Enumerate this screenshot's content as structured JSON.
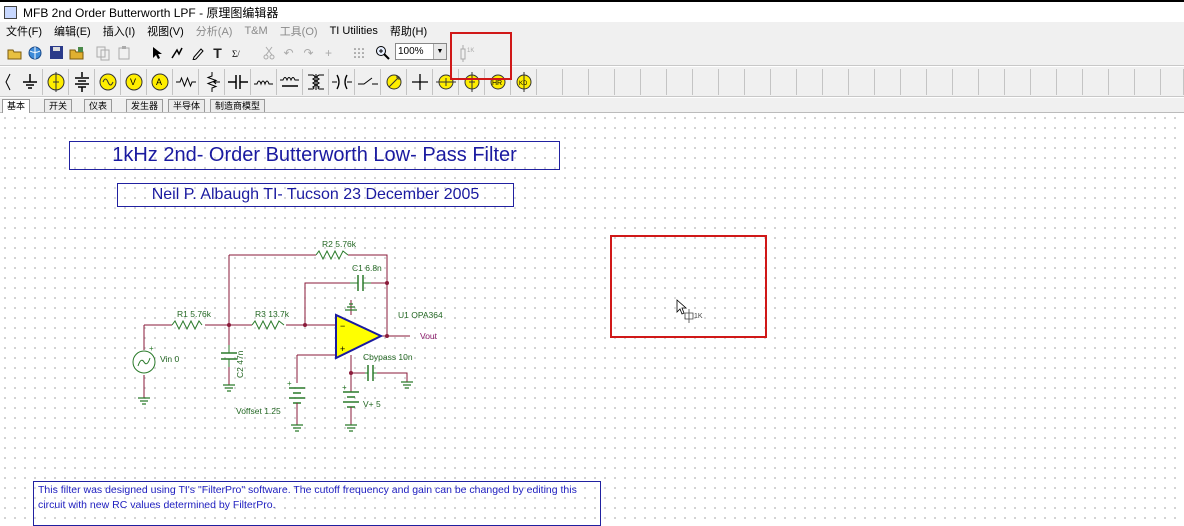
{
  "window": {
    "title": "MFB 2nd Order Butterworth LPF - 原理图编辑器"
  },
  "menu": [
    {
      "label": "文件(F)",
      "enabled": true
    },
    {
      "label": "编辑(E)",
      "enabled": true
    },
    {
      "label": "插入(I)",
      "enabled": true
    },
    {
      "label": "视图(V)",
      "enabled": true
    },
    {
      "label": "分析(A)",
      "enabled": false
    },
    {
      "label": "T&M",
      "enabled": false
    },
    {
      "label": "工具(O)",
      "enabled": false
    },
    {
      "label": "TI Utilities",
      "enabled": true
    },
    {
      "label": "帮助(H)",
      "enabled": true
    }
  ],
  "toolbar": {
    "zoom_value": "100%"
  },
  "tabs": [
    {
      "label": "基本",
      "active": true
    },
    {
      "label": "开关",
      "active": false
    },
    {
      "label": "仪表",
      "active": false
    },
    {
      "label": "发生器",
      "active": false
    },
    {
      "label": "半导体",
      "active": false
    },
    {
      "label": "制造商模型",
      "active": false
    }
  ],
  "schematic": {
    "title": "1kHz 2nd- Order Butterworth Low- Pass Filter",
    "author_line": "Neil P. Albaugh  TI- Tucson  23 December 2005",
    "components": {
      "r1": "R1 5.76k",
      "r2": "R2 5.76k",
      "r3": "R3 13.7k",
      "c1": "C1 6.8n",
      "c2": "C2 47n",
      "u1": "U1 OPA364",
      "vout": "Vout",
      "vin": "Vin 0",
      "cbypass": "Cbypass 10n",
      "vplus": "V+ 5",
      "voffset": "Voffset 1.25"
    },
    "note": "This filter was designed using TI's \"FilterPro\" software. The cutoff frequency and gain can be changed by editing this circuit with new RC values determined by FilterPro.",
    "cursor_label": "1K"
  },
  "colors": {
    "wire": "#8a1a3a",
    "component": "#2a7a2a",
    "opamp_fill": "#ffff00",
    "highlight_box": "#d01818",
    "title_text": "#1a1aa0"
  }
}
